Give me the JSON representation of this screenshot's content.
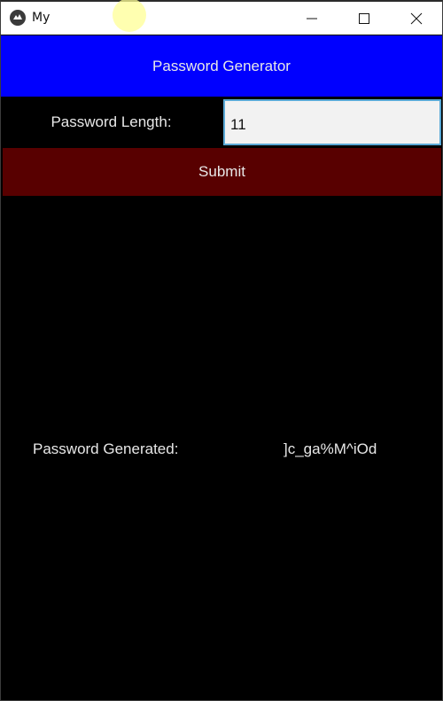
{
  "window": {
    "title": "My",
    "controls": {
      "minimize_icon": "minimize-icon",
      "maximize_icon": "maximize-icon",
      "close_icon": "close-icon"
    }
  },
  "header": {
    "title": "Password Generator",
    "color": "#0000ff"
  },
  "form": {
    "length_label": "Password Length:",
    "length_value": "11",
    "submit_label": "Submit",
    "submit_color": "#580000"
  },
  "result": {
    "label": "Password Generated:",
    "value": "]c_ga%M^iOd"
  }
}
